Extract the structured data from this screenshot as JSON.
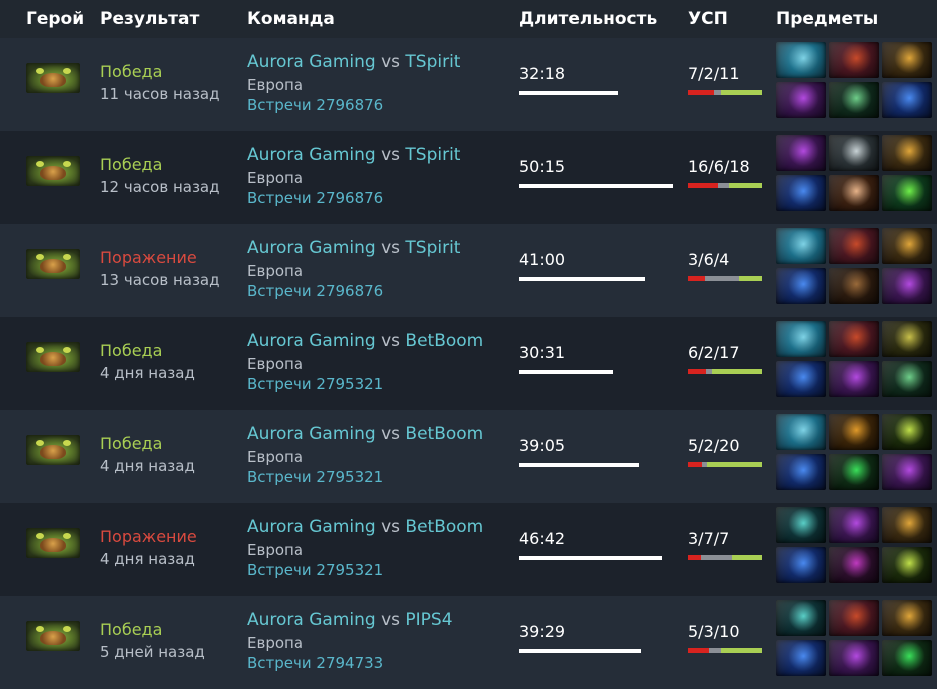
{
  "columns": {
    "hero": "Герой",
    "result": "Результат",
    "team": "Команда",
    "duration": "Длительность",
    "kda": "УСП",
    "items": "Предметы"
  },
  "colors": {
    "win": "#a9cf54",
    "loss": "#d94a3f",
    "team_link": "#66c7d2",
    "kda_kills": "#d8231f",
    "kda_deaths": "#8b8f96",
    "kda_assists": "#a9cf54"
  },
  "matches": [
    {
      "result": "Победа",
      "outcome": "win",
      "time_ago": "11 часов назад",
      "team1": "Aurora Gaming",
      "vs": "vs",
      "team2": "TSpirit",
      "region": "Европа",
      "series": "Встречи 2796876",
      "duration": "32:18",
      "kda": "7/2/11",
      "kda_values": [
        7,
        2,
        11
      ],
      "items": [
        "eul-blue-icon",
        "dagon-red-icon",
        "gold-helm-icon",
        "purple-staff-icon",
        "green-wand-icon",
        "blue-scepter-icon"
      ]
    },
    {
      "result": "Победа",
      "outcome": "win",
      "time_ago": "12 часов назад",
      "team1": "Aurora Gaming",
      "vs": "vs",
      "team2": "TSpirit",
      "region": "Европа",
      "series": "Встречи 2796876",
      "duration": "50:15",
      "kda": "16/6/18",
      "kda_values": [
        16,
        6,
        18
      ],
      "items": [
        "purple-staff-icon",
        "skull-mask-icon",
        "gold-helm-icon",
        "blue-scepter-icon",
        "round-shield-icon",
        "green-orb-icon"
      ]
    },
    {
      "result": "Поражение",
      "outcome": "loss",
      "time_ago": "13 часов назад",
      "team1": "Aurora Gaming",
      "vs": "vs",
      "team2": "TSpirit",
      "region": "Европа",
      "series": "Встречи 2796876",
      "duration": "41:00",
      "kda": "3/6/4",
      "kda_values": [
        3,
        6,
        4
      ],
      "items": [
        "eul-blue-icon",
        "dagon-red-icon",
        "gold-helm-icon",
        "blue-scepter-icon",
        "brown-cloak-icon",
        "purple-staff-icon"
      ]
    },
    {
      "result": "Победа",
      "outcome": "win",
      "time_ago": "4 дня назад",
      "team1": "Aurora Gaming",
      "vs": "vs",
      "team2": "BetBoom",
      "region": "Европа",
      "series": "Встречи 2795321",
      "duration": "30:31",
      "kda": "6/2/17",
      "kda_values": [
        6,
        2,
        17
      ],
      "items": [
        "eul-blue-icon",
        "dagon-red-icon",
        "gold-horn-icon",
        "blue-scepter-icon",
        "purple-staff-icon",
        "green-wand-icon"
      ]
    },
    {
      "result": "Победа",
      "outcome": "win",
      "time_ago": "4 дня назад",
      "team1": "Aurora Gaming",
      "vs": "vs",
      "team2": "BetBoom",
      "region": "Европа",
      "series": "Встречи 2795321",
      "duration": "39:05",
      "kda": "5/2/20",
      "kda_values": [
        5,
        2,
        20
      ],
      "items": [
        "eul-blue-icon",
        "amber-gauntlet-icon",
        "green-trident-icon",
        "blue-scepter-icon",
        "green-gem-icon",
        "purple-staff-icon"
      ]
    },
    {
      "result": "Поражение",
      "outcome": "loss",
      "time_ago": "4 дня назад",
      "team1": "Aurora Gaming",
      "vs": "vs",
      "team2": "BetBoom",
      "region": "Европа",
      "series": "Встречи 2795321",
      "duration": "46:42",
      "kda": "3/7/7",
      "kda_values": [
        3,
        7,
        7
      ],
      "items": [
        "teal-boots-icon",
        "purple-staff-icon",
        "gold-helm-icon",
        "blue-scepter-icon",
        "purple-cloak-icon",
        "green-trident-icon"
      ]
    },
    {
      "result": "Победа",
      "outcome": "win",
      "time_ago": "5 дней назад",
      "team1": "Aurora Gaming",
      "vs": "vs",
      "team2": "PIPS4",
      "region": "Европа",
      "series": "Встречи 2794733",
      "duration": "39:29",
      "kda": "5/3/10",
      "kda_values": [
        5,
        3,
        10
      ],
      "items": [
        "teal-boots-icon",
        "dagon-red-icon",
        "gold-helm-icon",
        "blue-scepter-icon",
        "purple-staff-icon",
        "green-gem-icon"
      ]
    }
  ],
  "duration_fractions": [
    0.64,
    1.0,
    0.82,
    0.61,
    0.78,
    0.93,
    0.79
  ],
  "item_palette": {
    "eul-blue-icon": [
      "#1b6f8a",
      "#7fd3e6",
      "#0b2b3a"
    ],
    "dagon-red-icon": [
      "#4a1620",
      "#c84a2a",
      "#1a0a10"
    ],
    "gold-helm-icon": [
      "#3a2a10",
      "#e0a63a",
      "#140c05"
    ],
    "purple-staff-icon": [
      "#3a1550",
      "#b34ae0",
      "#120620"
    ],
    "green-wand-icon": [
      "#0f2a1c",
      "#6fcf8a",
      "#05120a"
    ],
    "blue-scepter-icon": [
      "#112a6a",
      "#4a8af0",
      "#050c24"
    ],
    "skull-mask-icon": [
      "#2a3236",
      "#c9d3d6",
      "#0e1214"
    ],
    "round-shield-icon": [
      "#3a2010",
      "#e8b48a",
      "#140805"
    ],
    "green-orb-icon": [
      "#0d3a1c",
      "#6ff04a",
      "#041408"
    ],
    "brown-cloak-icon": [
      "#2a1a0e",
      "#9a6a3a",
      "#0e0804"
    ],
    "gold-horn-icon": [
      "#2a2a0e",
      "#c8c04a",
      "#0e0e04"
    ],
    "amber-gauntlet-icon": [
      "#3a2408",
      "#e09a2a",
      "#140a02"
    ],
    "green-trident-icon": [
      "#1a2a0a",
      "#c0e04a",
      "#080e02"
    ],
    "green-gem-icon": [
      "#0e2a14",
      "#3ae05a",
      "#040e06"
    ],
    "teal-boots-icon": [
      "#0e3236",
      "#5ad0c8",
      "#041214"
    ],
    "purple-cloak-icon": [
      "#2a0e2a",
      "#c03ac0",
      "#0e040e"
    ]
  }
}
